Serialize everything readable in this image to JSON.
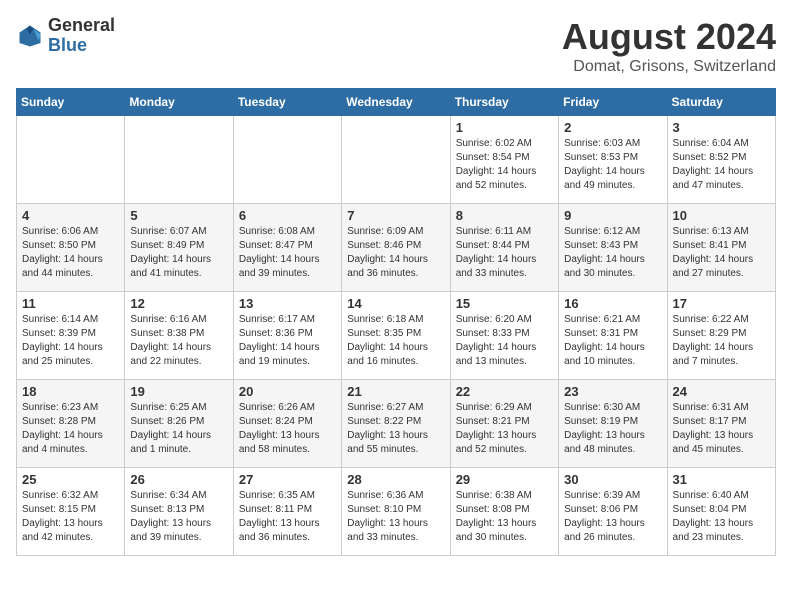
{
  "header": {
    "logo_general": "General",
    "logo_blue": "Blue",
    "title": "August 2024",
    "subtitle": "Domat, Grisons, Switzerland"
  },
  "weekdays": [
    "Sunday",
    "Monday",
    "Tuesday",
    "Wednesday",
    "Thursday",
    "Friday",
    "Saturday"
  ],
  "weeks": [
    [
      {
        "day": "",
        "detail": ""
      },
      {
        "day": "",
        "detail": ""
      },
      {
        "day": "",
        "detail": ""
      },
      {
        "day": "",
        "detail": ""
      },
      {
        "day": "1",
        "detail": "Sunrise: 6:02 AM\nSunset: 8:54 PM\nDaylight: 14 hours\nand 52 minutes."
      },
      {
        "day": "2",
        "detail": "Sunrise: 6:03 AM\nSunset: 8:53 PM\nDaylight: 14 hours\nand 49 minutes."
      },
      {
        "day": "3",
        "detail": "Sunrise: 6:04 AM\nSunset: 8:52 PM\nDaylight: 14 hours\nand 47 minutes."
      }
    ],
    [
      {
        "day": "4",
        "detail": "Sunrise: 6:06 AM\nSunset: 8:50 PM\nDaylight: 14 hours\nand 44 minutes."
      },
      {
        "day": "5",
        "detail": "Sunrise: 6:07 AM\nSunset: 8:49 PM\nDaylight: 14 hours\nand 41 minutes."
      },
      {
        "day": "6",
        "detail": "Sunrise: 6:08 AM\nSunset: 8:47 PM\nDaylight: 14 hours\nand 39 minutes."
      },
      {
        "day": "7",
        "detail": "Sunrise: 6:09 AM\nSunset: 8:46 PM\nDaylight: 14 hours\nand 36 minutes."
      },
      {
        "day": "8",
        "detail": "Sunrise: 6:11 AM\nSunset: 8:44 PM\nDaylight: 14 hours\nand 33 minutes."
      },
      {
        "day": "9",
        "detail": "Sunrise: 6:12 AM\nSunset: 8:43 PM\nDaylight: 14 hours\nand 30 minutes."
      },
      {
        "day": "10",
        "detail": "Sunrise: 6:13 AM\nSunset: 8:41 PM\nDaylight: 14 hours\nand 27 minutes."
      }
    ],
    [
      {
        "day": "11",
        "detail": "Sunrise: 6:14 AM\nSunset: 8:39 PM\nDaylight: 14 hours\nand 25 minutes."
      },
      {
        "day": "12",
        "detail": "Sunrise: 6:16 AM\nSunset: 8:38 PM\nDaylight: 14 hours\nand 22 minutes."
      },
      {
        "day": "13",
        "detail": "Sunrise: 6:17 AM\nSunset: 8:36 PM\nDaylight: 14 hours\nand 19 minutes."
      },
      {
        "day": "14",
        "detail": "Sunrise: 6:18 AM\nSunset: 8:35 PM\nDaylight: 14 hours\nand 16 minutes."
      },
      {
        "day": "15",
        "detail": "Sunrise: 6:20 AM\nSunset: 8:33 PM\nDaylight: 14 hours\nand 13 minutes."
      },
      {
        "day": "16",
        "detail": "Sunrise: 6:21 AM\nSunset: 8:31 PM\nDaylight: 14 hours\nand 10 minutes."
      },
      {
        "day": "17",
        "detail": "Sunrise: 6:22 AM\nSunset: 8:29 PM\nDaylight: 14 hours\nand 7 minutes."
      }
    ],
    [
      {
        "day": "18",
        "detail": "Sunrise: 6:23 AM\nSunset: 8:28 PM\nDaylight: 14 hours\nand 4 minutes."
      },
      {
        "day": "19",
        "detail": "Sunrise: 6:25 AM\nSunset: 8:26 PM\nDaylight: 14 hours\nand 1 minute."
      },
      {
        "day": "20",
        "detail": "Sunrise: 6:26 AM\nSunset: 8:24 PM\nDaylight: 13 hours\nand 58 minutes."
      },
      {
        "day": "21",
        "detail": "Sunrise: 6:27 AM\nSunset: 8:22 PM\nDaylight: 13 hours\nand 55 minutes."
      },
      {
        "day": "22",
        "detail": "Sunrise: 6:29 AM\nSunset: 8:21 PM\nDaylight: 13 hours\nand 52 minutes."
      },
      {
        "day": "23",
        "detail": "Sunrise: 6:30 AM\nSunset: 8:19 PM\nDaylight: 13 hours\nand 48 minutes."
      },
      {
        "day": "24",
        "detail": "Sunrise: 6:31 AM\nSunset: 8:17 PM\nDaylight: 13 hours\nand 45 minutes."
      }
    ],
    [
      {
        "day": "25",
        "detail": "Sunrise: 6:32 AM\nSunset: 8:15 PM\nDaylight: 13 hours\nand 42 minutes."
      },
      {
        "day": "26",
        "detail": "Sunrise: 6:34 AM\nSunset: 8:13 PM\nDaylight: 13 hours\nand 39 minutes."
      },
      {
        "day": "27",
        "detail": "Sunrise: 6:35 AM\nSunset: 8:11 PM\nDaylight: 13 hours\nand 36 minutes."
      },
      {
        "day": "28",
        "detail": "Sunrise: 6:36 AM\nSunset: 8:10 PM\nDaylight: 13 hours\nand 33 minutes."
      },
      {
        "day": "29",
        "detail": "Sunrise: 6:38 AM\nSunset: 8:08 PM\nDaylight: 13 hours\nand 30 minutes."
      },
      {
        "day": "30",
        "detail": "Sunrise: 6:39 AM\nSunset: 8:06 PM\nDaylight: 13 hours\nand 26 minutes."
      },
      {
        "day": "31",
        "detail": "Sunrise: 6:40 AM\nSunset: 8:04 PM\nDaylight: 13 hours\nand 23 minutes."
      }
    ]
  ]
}
